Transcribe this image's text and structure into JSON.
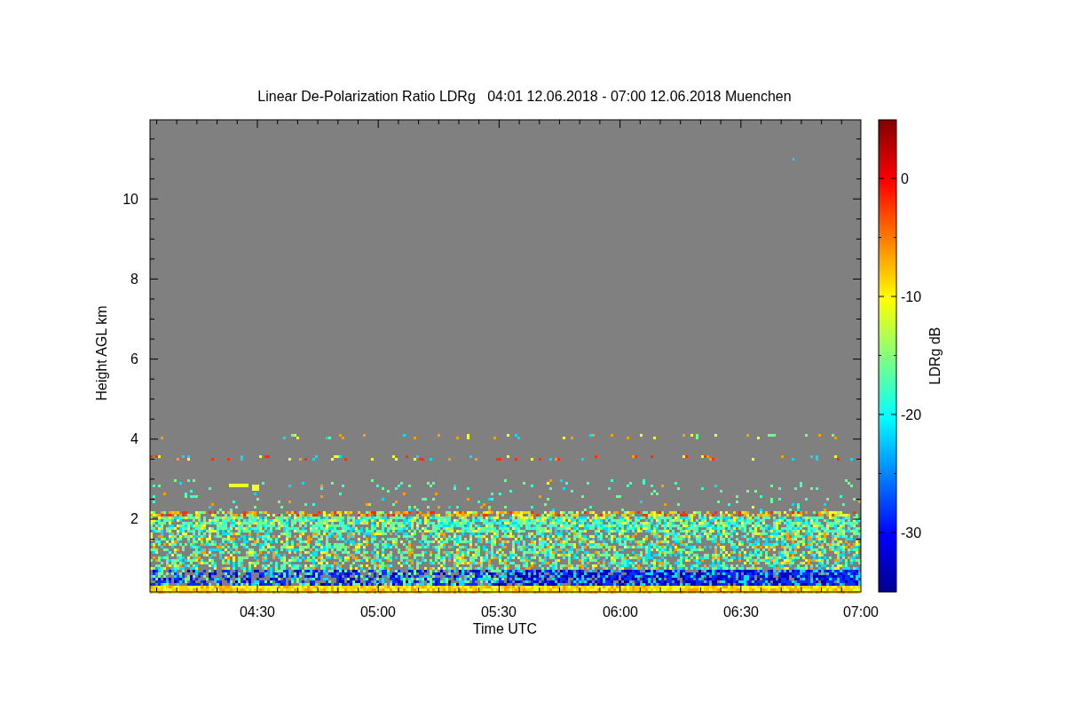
{
  "title": "Linear De-Polarization Ratio LDRg   04:01 12.06.2018 - 07:00 12.06.2018 Muenchen",
  "xlabel": "Time UTC",
  "ylabel": "Height AGL km",
  "xticks": [
    "04:30",
    "05:00",
    "05:30",
    "06:00",
    "06:30",
    "07:00"
  ],
  "yticks": [
    "10",
    "8",
    "6",
    "4",
    "2"
  ],
  "colorbar": {
    "label": "LDRg dB",
    "ticks": [
      "0",
      "-10",
      "-20",
      "-30"
    ]
  }
}
